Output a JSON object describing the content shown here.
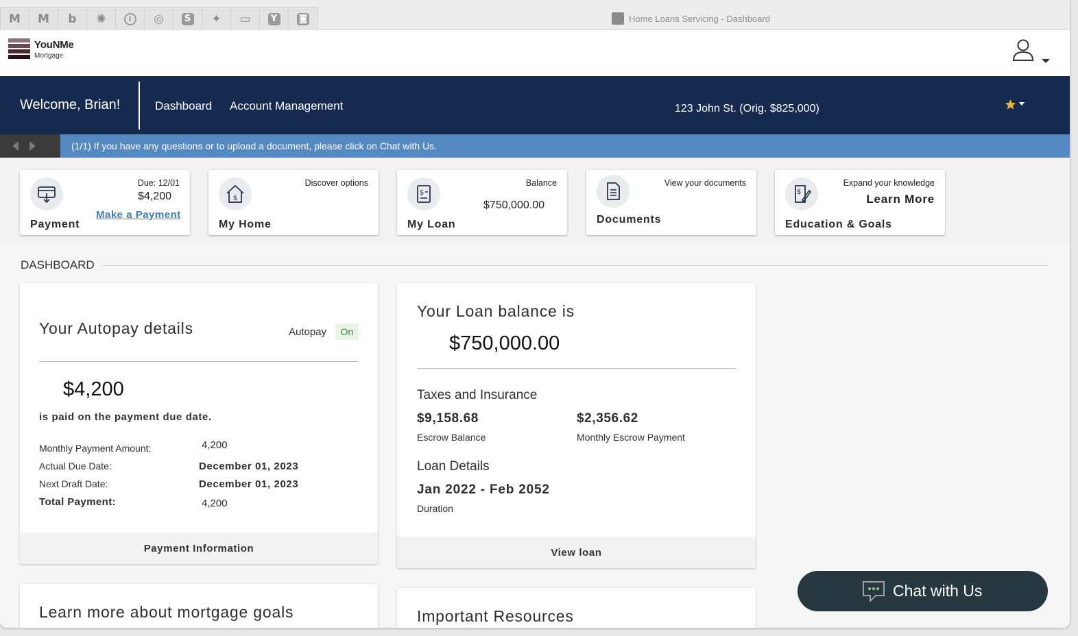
{
  "browser": {
    "window_title": "Home Loans Servicing - Dashboard",
    "pinned_tabs": [
      {
        "icon": "gmail-icon",
        "glyph": "M"
      },
      {
        "icon": "gmail-icon-2",
        "glyph": "M"
      },
      {
        "icon": "b-app-icon",
        "glyph": "b"
      },
      {
        "icon": "gear-app-icon",
        "glyph": "✺"
      },
      {
        "icon": "info-app-icon",
        "glyph": "i"
      },
      {
        "icon": "openai-icon",
        "glyph": "◎"
      },
      {
        "icon": "s-app-icon",
        "glyph": "S"
      },
      {
        "icon": "sparkle-icon",
        "glyph": "✦"
      },
      {
        "icon": "gmaps-icon",
        "glyph": "▭"
      },
      {
        "icon": "y-app-icon",
        "glyph": "Y"
      },
      {
        "icon": "camera-app-icon",
        "glyph": "◙"
      }
    ]
  },
  "brand": {
    "name": "YouNMe",
    "subtitle": "Mortgage",
    "colors": [
      "#8a7376",
      "#6b4b4f",
      "#4a2b30",
      "#2c0f15"
    ]
  },
  "nav": {
    "welcome": "Welcome, Brian!",
    "links": [
      "Dashboard",
      "Account Management"
    ],
    "property": "123 John St. (Orig. $825,000)",
    "background": "#152a4e"
  },
  "announcement": {
    "text": "(1/1) If you have any questions or to upload a document, please click on Chat with Us."
  },
  "quick_cards": {
    "payment": {
      "title": "Payment",
      "due": "Due: 12/01",
      "amount": "$4,200",
      "link": "Make a Payment"
    },
    "home": {
      "title": "My Home",
      "note": "Discover options"
    },
    "loan": {
      "title": "My Loan",
      "note": "Balance",
      "amount": "$750,000.00"
    },
    "documents": {
      "title": "Documents",
      "note": "View your documents"
    },
    "education": {
      "title": "Education & Goals",
      "note": "Expand your knowledge",
      "cta": "Learn More"
    }
  },
  "dashboard": {
    "heading": "DASHBOARD",
    "autopay": {
      "title": "Your Autopay details",
      "status_label": "Autopay",
      "status_value": "On",
      "amount": "$4,200",
      "subtitle": "is paid on the payment due date.",
      "rows": [
        {
          "label": "Monthly Payment Amount:",
          "value": "4,200"
        },
        {
          "label": "Actual Due Date:",
          "value": "December 01, 2023"
        },
        {
          "label": "Next Draft Date:",
          "value": "December 01, 2023"
        },
        {
          "label": "Total Payment:",
          "value": "4,200"
        }
      ],
      "footer": "Payment Information"
    },
    "loan": {
      "title": "Your Loan balance is",
      "balance": "$750,000.00",
      "taxes_heading": "Taxes and Insurance",
      "escrow_balance": "$9,158.68",
      "escrow_balance_label": "Escrow Balance",
      "monthly_escrow": "$2,356.62",
      "monthly_escrow_label": "Monthly Escrow Payment",
      "details_heading": "Loan Details",
      "duration": "Jan 2022 - Feb 2052",
      "duration_label": "Duration",
      "footer": "View loan"
    },
    "goals_title": "Learn more about mortgage goals",
    "resources_title": "Important Resources"
  },
  "chat": {
    "label": "Chat with Us"
  }
}
